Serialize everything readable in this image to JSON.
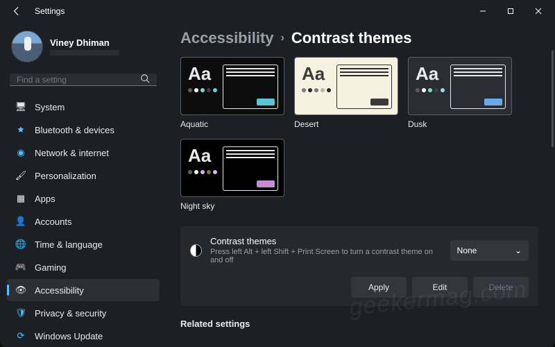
{
  "window": {
    "title": "Settings"
  },
  "user": {
    "name": "Viney Dhiman"
  },
  "search": {
    "placeholder": "Find a setting"
  },
  "sidebar": {
    "items": [
      {
        "label": "System",
        "icon": "💻"
      },
      {
        "label": "Bluetooth & devices",
        "icon": "bt"
      },
      {
        "label": "Network & internet",
        "icon": "📶"
      },
      {
        "label": "Personalization",
        "icon": "🎨"
      },
      {
        "label": "Apps",
        "icon": "▦"
      },
      {
        "label": "Accounts",
        "icon": "👤"
      },
      {
        "label": "Time & language",
        "icon": "🌐"
      },
      {
        "label": "Gaming",
        "icon": "🎮"
      },
      {
        "label": "Accessibility",
        "icon": "♿"
      },
      {
        "label": "Privacy & security",
        "icon": "🛡"
      },
      {
        "label": "Windows Update",
        "icon": "🔄"
      }
    ],
    "active_index": 8
  },
  "breadcrumb": {
    "parent": "Accessibility",
    "current": "Contrast themes"
  },
  "themes": [
    {
      "label": "Aquatic",
      "class": "t-aquatic"
    },
    {
      "label": "Desert",
      "class": "t-desert"
    },
    {
      "label": "Dusk",
      "class": "t-dusk"
    },
    {
      "label": "Night sky",
      "class": "t-night"
    }
  ],
  "contrast_panel": {
    "title": "Contrast themes",
    "subtitle": "Press left Alt + left Shift + Print Screen to turn a contrast theme on and off",
    "dropdown_value": "None",
    "buttons": {
      "apply": "Apply",
      "edit": "Edit",
      "delete": "Delete"
    }
  },
  "related_heading": "Related settings",
  "watermark": "geekermag.com"
}
